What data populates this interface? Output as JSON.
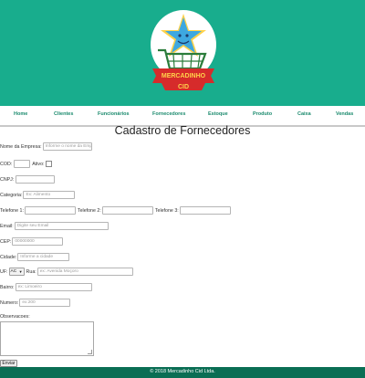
{
  "brand": {
    "logo_text_1": "MERCADINHO",
    "logo_text_2": "CID",
    "colors": {
      "header": "#18ad8d",
      "footer": "#0a6e54",
      "nav_text": "#1a8a6d",
      "logo_ribbon": "#d62b2b",
      "logo_star": "#3ea8e0"
    }
  },
  "nav": {
    "items": [
      "Home",
      "Clientes",
      "Funcionários",
      "Fornecedores",
      "Estoque",
      "Produto",
      "Caixa",
      "Vendas"
    ]
  },
  "page": {
    "title": "Cadastro de Fornecedores"
  },
  "form": {
    "nome_label": "Nome da Empresa:",
    "nome_placeholder": "Informe o nome da Empresa",
    "cod_label": "COD:",
    "ativo_label": "Ativo:",
    "cnpj_label": "CNPJ:",
    "categoria_label": "Categoria:",
    "categoria_placeholder": "Ex: Alimento",
    "tel1_label": "Telefone 1:",
    "tel2_label": "Telefone 2:",
    "tel3_label": "Telefone 3:",
    "email_label": "Email:",
    "email_placeholder": "Digite seu Email",
    "cep_label": "CEP:",
    "cep_placeholder": "00000000",
    "cidade_label": "Cidade:",
    "cidade_placeholder": "Informe a cidade",
    "uf_label": "UF:",
    "uf_value": "AC",
    "rua_label": "Rua:",
    "rua_placeholder": "ex: Avenida Moçoro",
    "bairro_label": "Bairro:",
    "bairro_placeholder": "ex: Limoeiro",
    "numero_label": "Numero:",
    "numero_placeholder": "ex:200",
    "obs_label": "Observacoes:",
    "submit_label": "Enviar"
  },
  "footer": {
    "text": "© 2018 Mercadinho Cid Ltda."
  }
}
